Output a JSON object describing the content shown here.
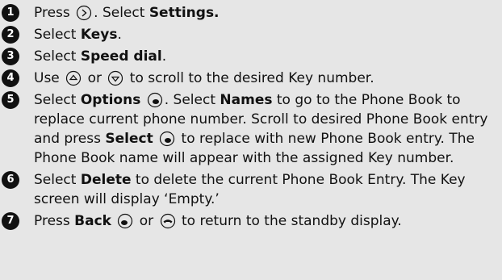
{
  "steps": [
    {
      "num": "1",
      "segments": [
        {
          "t": "Press "
        },
        {
          "icon": "menu-key-icon"
        },
        {
          "t": ". Select "
        },
        {
          "b": "Settings."
        }
      ]
    },
    {
      "num": "2",
      "segments": [
        {
          "t": "Select "
        },
        {
          "b": "Keys"
        },
        {
          "t": "."
        }
      ]
    },
    {
      "num": "3",
      "segments": [
        {
          "t": "Select "
        },
        {
          "b": "Speed dial"
        },
        {
          "t": "."
        }
      ]
    },
    {
      "num": "4",
      "segments": [
        {
          "t": "Use "
        },
        {
          "icon": "scroll-up-key-icon"
        },
        {
          "t": " or "
        },
        {
          "icon": "scroll-down-key-icon"
        },
        {
          "t": " to scroll to the desired Key number."
        }
      ]
    },
    {
      "num": "5",
      "segments": [
        {
          "t": "Select "
        },
        {
          "b": "Options"
        },
        {
          "t": " "
        },
        {
          "icon": "right-softkey-icon"
        },
        {
          "t": ". Select "
        },
        {
          "b": "Names"
        },
        {
          "t": " to go to the Phone Book to replace current phone number. Scroll to desired Phone Book entry and press "
        },
        {
          "b": "Select"
        },
        {
          "t": " "
        },
        {
          "icon": "right-softkey-icon"
        },
        {
          "t": " to replace with new Phone Book entry. The Phone Book name will appear with the assigned Key number."
        }
      ]
    },
    {
      "num": "6",
      "segments": [
        {
          "t": "Select "
        },
        {
          "b": "Delete"
        },
        {
          "t": " to delete the current Phone Book Entry. The Key screen will display ‘Empty.’"
        }
      ]
    },
    {
      "num": "7",
      "segments": [
        {
          "t": "Press "
        },
        {
          "b": "Back"
        },
        {
          "t": " "
        },
        {
          "icon": "left-softkey-icon"
        },
        {
          "t": " or "
        },
        {
          "icon": "end-key-icon"
        },
        {
          "t": " to return to the standby display."
        }
      ]
    }
  ]
}
